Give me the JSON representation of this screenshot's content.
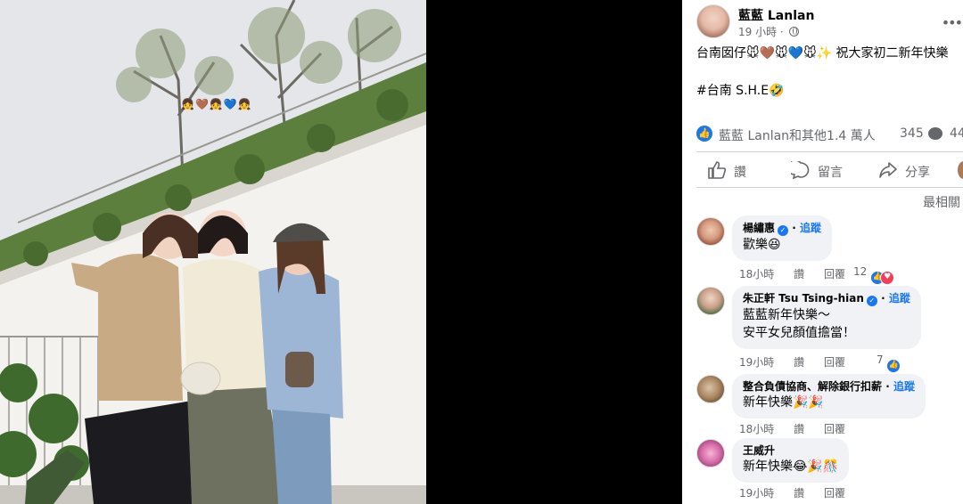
{
  "post": {
    "author": "藍藍 Lanlan",
    "time": "19 小時 ·",
    "text": "台南囡仔🐭🤎🐭💙🐭✨ 祝大家初二新年快樂",
    "hashtag": "#台南 S.H.E🤣",
    "reactions_text": "藍藍 Lanlan和其他1.4 萬人",
    "comment_count": "345",
    "share_count": "44",
    "sort_label": "最相關"
  },
  "actions": {
    "like": "讚",
    "comment": "留言",
    "share": "分享"
  },
  "comments": [
    {
      "name": "楊繡惠",
      "follow": "追蹤",
      "text": "歡樂😆",
      "time": "18小時",
      "like": "讚",
      "reply": "回覆",
      "reactions": "12"
    },
    {
      "name": "朱正軒 Tsu Tsing-hian",
      "follow": "追蹤",
      "text": "藍藍新年快樂～",
      "text2": "安平女兒顏值擔當！",
      "time": "19小時",
      "like": "讚",
      "reply": "回覆",
      "reactions": "7"
    },
    {
      "name": "整合負債協商、解除銀行扣薪",
      "follow": "追蹤",
      "text": "新年快樂🎉🎉",
      "time": "18小時",
      "like": "讚",
      "reply": "回覆"
    },
    {
      "name": "王威升",
      "text": "新年快樂😂🎉🎊",
      "time": "19小時",
      "like": "讚",
      "reply": "回覆"
    }
  ],
  "photo": {
    "overlay_emoji": "👧🤎👧💙👧"
  }
}
